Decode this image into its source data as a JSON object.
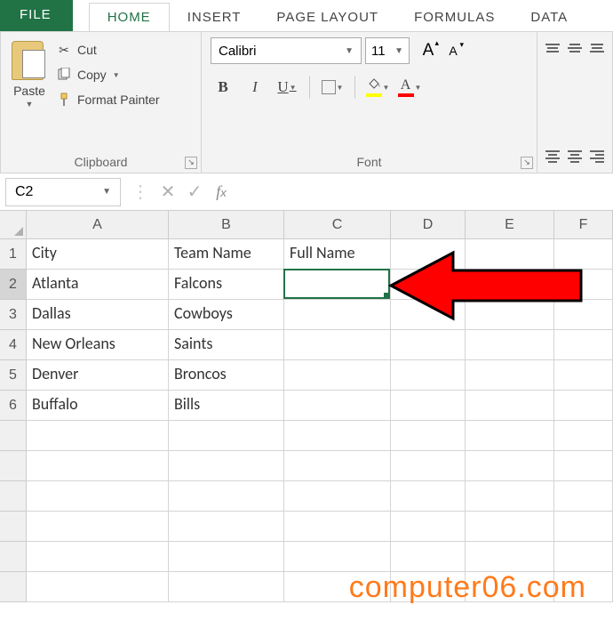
{
  "tabs": {
    "file": "FILE",
    "items": [
      "HOME",
      "INSERT",
      "PAGE LAYOUT",
      "FORMULAS",
      "DATA"
    ],
    "active": "HOME"
  },
  "ribbon": {
    "clipboard": {
      "paste": "Paste",
      "cut": "Cut",
      "copy": "Copy",
      "format_painter": "Format Painter",
      "group_label": "Clipboard"
    },
    "font": {
      "name": "Calibri",
      "size": "11",
      "group_label": "Font"
    }
  },
  "namebox": "C2",
  "grid": {
    "columns": [
      "A",
      "B",
      "C",
      "D",
      "E",
      "F"
    ],
    "rows": [
      {
        "n": "1",
        "A": "City",
        "B": "Team Name",
        "C": "Full Name"
      },
      {
        "n": "2",
        "A": "Atlanta",
        "B": "Falcons",
        "C": ""
      },
      {
        "n": "3",
        "A": "Dallas",
        "B": "Cowboys",
        "C": ""
      },
      {
        "n": "4",
        "A": "New Orleans",
        "B": "Saints",
        "C": ""
      },
      {
        "n": "5",
        "A": "Denver",
        "B": "Broncos",
        "C": ""
      },
      {
        "n": "6",
        "A": "Buffalo",
        "B": "Bills",
        "C": ""
      }
    ],
    "active_cell": "C2"
  },
  "watermark": "computer06.com"
}
